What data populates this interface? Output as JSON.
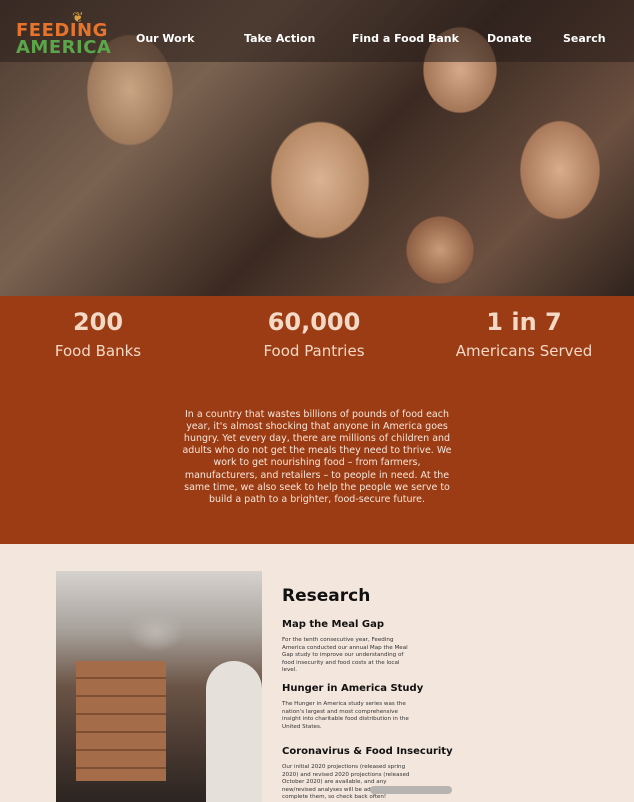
{
  "logo": {
    "line1": "FEEDING",
    "line2": "AMERICA"
  },
  "nav": {
    "items": [
      "Our Work",
      "Take Action",
      "Find a Food Bank",
      "Donate",
      "Search"
    ]
  },
  "stats": [
    {
      "value": "200",
      "label": "Food Banks"
    },
    {
      "value": "60,000",
      "label": "Food Pantries"
    },
    {
      "value": "1 in 7",
      "label": "Americans Served"
    }
  ],
  "mission": "In a country that wastes billions of pounds of food each year, it's almost shocking that anyone in America goes hungry. Yet every day, there are millions of children and adults who do not get the meals they need to thrive. We work to get nourishing food – from farmers, manufacturers, and retailers – to people in need. At the same time, we also seek to help the people we serve to build a path to a brighter, food-secure future.",
  "research": {
    "title": "Research",
    "items": [
      {
        "heading": "Map the Meal Gap",
        "body": "For the tenth consecutive year, Feeding America conducted our annual Map the Meal Gap study to improve our understanding of food insecurity and food costs at the local level."
      },
      {
        "heading": "Hunger in America Study",
        "body": "The Hunger in America study series was the nation's largest and most comprehensive insight into charitable food distribution in the United States."
      },
      {
        "heading": "Coronavirus & Food Insecurity",
        "body": "Our initial 2020 projections (released spring 2020) and revised 2020 projections (released October 2020) are available, and any new/revised analyses will be added as we complete them, so check back often!"
      }
    ]
  },
  "colors": {
    "brand_brown": "#9c3c14",
    "cream": "#f3e6dc",
    "orange": "#e8742c",
    "green": "#5ba64a"
  }
}
